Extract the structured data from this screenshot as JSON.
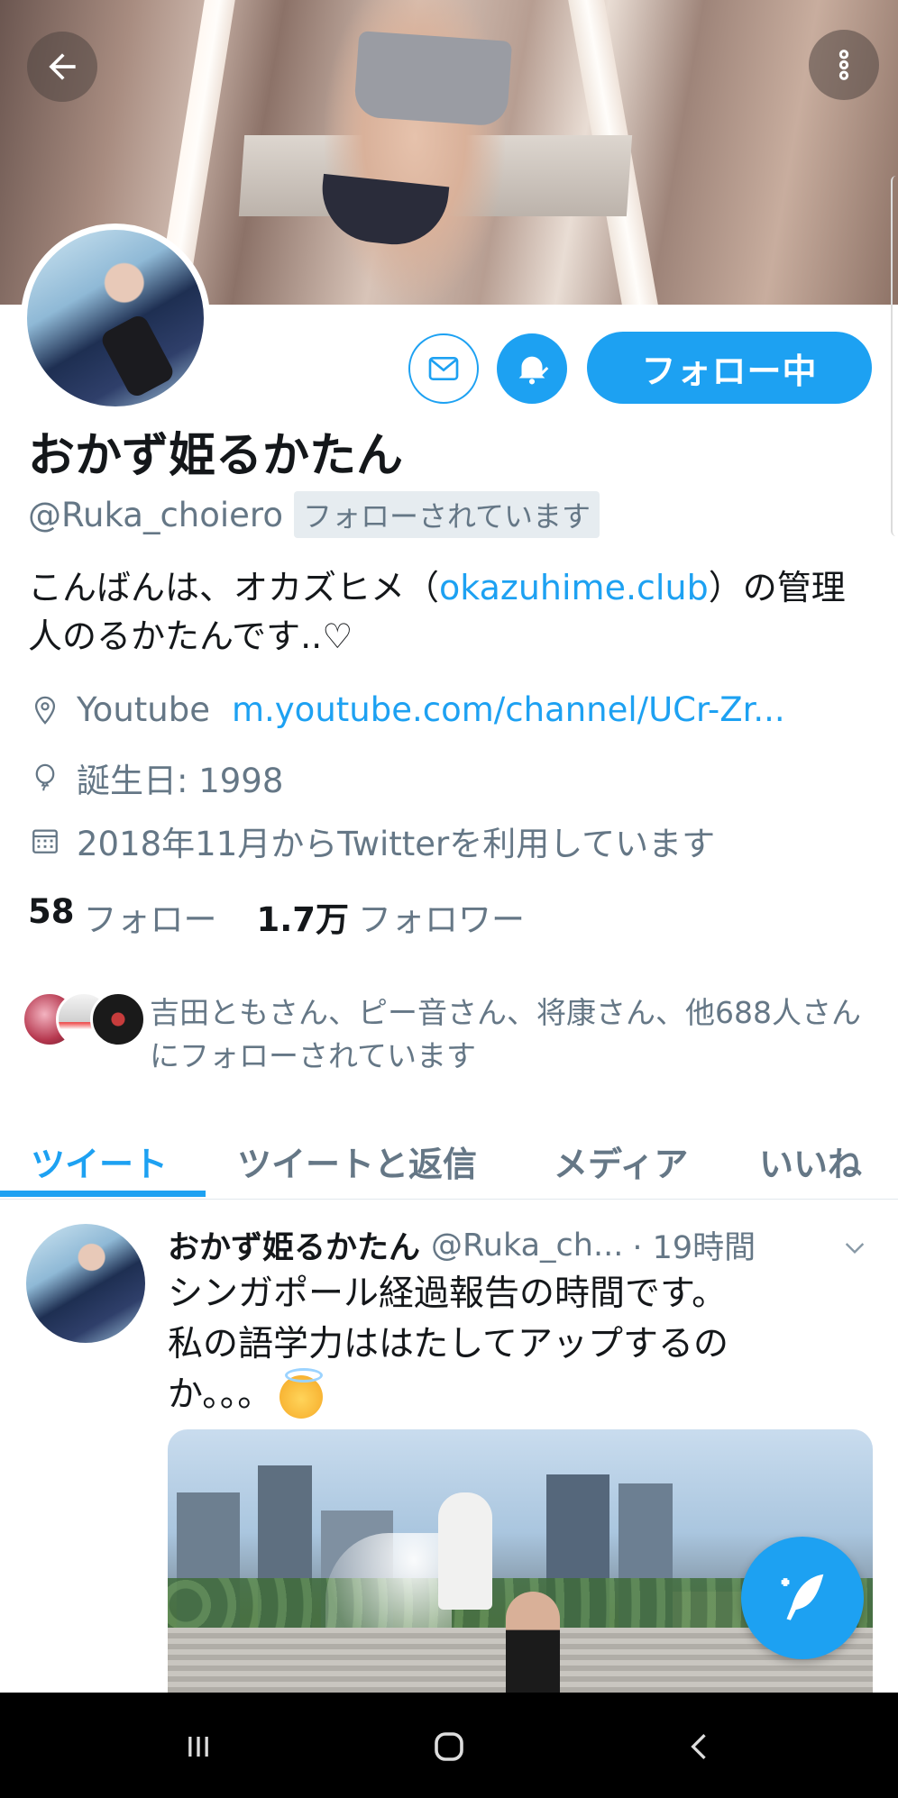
{
  "header": {
    "back_icon": "arrow-left-icon",
    "more_icon": "more-vertical-icon"
  },
  "profile": {
    "display_name": "おかず姫るかたん",
    "handle": "@Ruka_choiero",
    "follows_you_badge": "フォローされています",
    "bio_before": "こんばんは、オカズヒメ（",
    "bio_link": "okazuhime.club",
    "bio_after": "）の管理人のるかたんです..♡",
    "location_label": "Youtube",
    "location_link": "m.youtube.com/channel/UCr-Zr...",
    "birthday": "誕生日: 1998",
    "joined": "2018年11月からTwitterを利用しています",
    "following_count": "58",
    "following_label": "フォロー",
    "followers_count": "1.7万",
    "followers_label": "フォロワー",
    "mutuals_text": "吉田ともさん、ピー音さん、将康さん、他688人さんにフォローされています"
  },
  "actions": {
    "follow_button": "フォロー中",
    "message_icon": "mail-icon",
    "notify_icon": "bell-check-icon"
  },
  "tabs": [
    {
      "label": "ツイート",
      "active": true
    },
    {
      "label": "ツイートと返信",
      "active": false
    },
    {
      "label": "メディア",
      "active": false
    },
    {
      "label": "いいね",
      "active": false
    }
  ],
  "tweet": {
    "name": "おかず姫るかたん",
    "handle": "@Ruka_ch...",
    "time": "· 19時間",
    "line1": "シンガポール経過報告の時間です。",
    "line2": "私の語学力ははたしてアップするの",
    "line3": "か。。。"
  },
  "fab": {
    "icon": "compose-tweet-icon"
  },
  "system_nav": {
    "recent_icon": "recent-apps-icon",
    "home_icon": "home-icon",
    "back_icon": "back-chevron-icon"
  },
  "colors": {
    "accent": "#1da1f2",
    "secondary_text": "#657786",
    "primary_text": "#14171a"
  }
}
